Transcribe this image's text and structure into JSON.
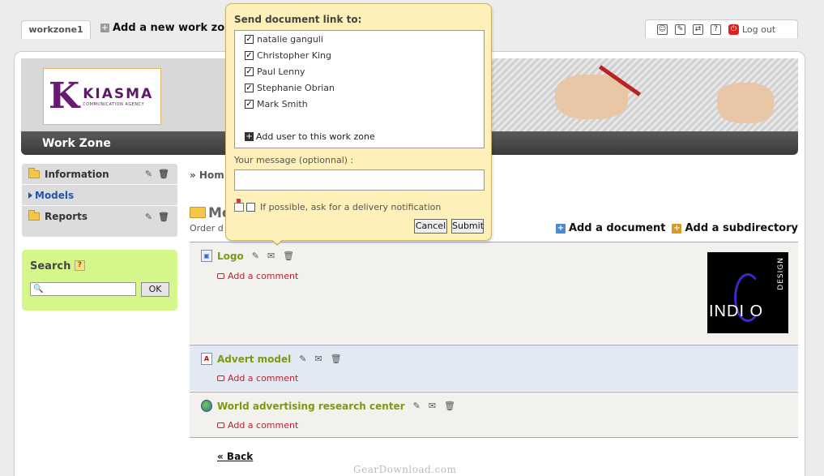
{
  "tabs": {
    "workzone_tab": "workzone1",
    "add_workzone": "Add a new work zone"
  },
  "userbar": {
    "logout": "Log out",
    "icons": [
      "profile-icon",
      "edit-icon",
      "settings-icon",
      "help-icon",
      "power-icon"
    ]
  },
  "banner": {
    "logo_text": "KIASMA",
    "logo_sub": "COMMUNICATION AGENCY",
    "logo_letter": "K",
    "title": "Work Zone"
  },
  "sidebar": {
    "items": [
      {
        "label": "Information"
      },
      {
        "label": "Models"
      },
      {
        "label": "Reports"
      }
    ],
    "search_title": "Search",
    "search_help": "?",
    "search_button": "OK"
  },
  "content": {
    "breadcrumb": "» Hom",
    "title": "Mo",
    "order_text": "Order d",
    "add_document": "Add a document",
    "add_subdirectory": "Add a subdirectory",
    "documents": [
      {
        "title": "Logo",
        "comment": "Add a comment"
      },
      {
        "title": "Advert model",
        "comment": "Add a comment"
      },
      {
        "title": "World advertising research center",
        "comment": "Add a comment"
      }
    ],
    "thumbnail": {
      "word": "INDI O",
      "design": "DESIGN"
    },
    "back": "« Back"
  },
  "popup": {
    "title": "Send document link to:",
    "users": [
      {
        "name": "natalie ganguli",
        "checked": true
      },
      {
        "name": "Christopher King",
        "checked": true
      },
      {
        "name": "Paul Lenny",
        "checked": true
      },
      {
        "name": "Stephanie Obrian",
        "checked": true
      },
      {
        "name": "Mark Smith",
        "checked": true
      }
    ],
    "add_user": "Add user to this work zone",
    "message_label": "Your message (optionnal) :",
    "message_value": "",
    "notify_label": "If possible, ask for a delivery notification",
    "cancel": "Cancel",
    "submit": "Submit"
  },
  "watermark": "GearDownload.com"
}
